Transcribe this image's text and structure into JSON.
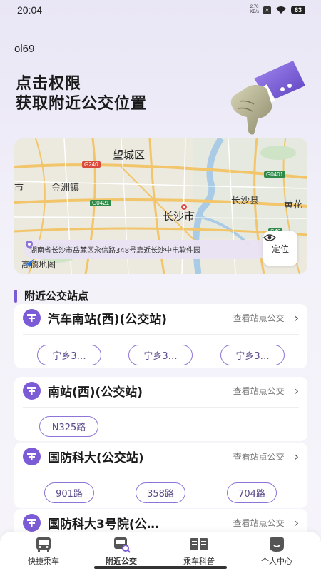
{
  "status_bar": {
    "time": "20:04",
    "net_speed_value": "2.70",
    "net_speed_unit": "KB/s",
    "battery": "63"
  },
  "app_code": "ol69",
  "headline": {
    "line1": "点击权限",
    "line2": "获取附近公交位置"
  },
  "map": {
    "labels": {
      "wangcheng": "望城区",
      "jinzhou": "金洲镇",
      "changsha_county": "长沙县",
      "changsha_city": "长沙市",
      "huanghua": "黄花",
      "edge_left": "市"
    },
    "road_tags": {
      "g240": "G240",
      "g0421": "G0421",
      "g0401": "G0401",
      "s40": "S40"
    },
    "address": "湖南省长沙市岳麓区永信路348号靠近长沙中电软件园",
    "locate_label": "定位",
    "logo_text": "高德地图"
  },
  "section": {
    "title": "附近公交站点"
  },
  "stops": [
    {
      "name": "汽车南站(西)(公交站)",
      "see_more": "查看站点公交",
      "routes": [
        "宁乡3…",
        "宁乡3…",
        "宁乡3…"
      ]
    },
    {
      "name": "南站(西)(公交站)",
      "see_more": "查看站点公交",
      "routes": [
        "N325路"
      ]
    },
    {
      "name": "国防科大(公交站)",
      "see_more": "查看站点公交",
      "routes": [
        "901路",
        "358路",
        "704路"
      ]
    },
    {
      "name": "国防科大3号院(公…",
      "see_more": "查看站点公交",
      "routes": []
    }
  ],
  "bottom_nav": [
    {
      "label": "快捷乘车",
      "icon": "bus-front-icon"
    },
    {
      "label": "附近公交",
      "icon": "bus-search-icon",
      "active": true
    },
    {
      "label": "乘车科普",
      "icon": "book-icon"
    },
    {
      "label": "个人中心",
      "icon": "smile-icon"
    }
  ],
  "colors": {
    "accent": "#7b5cd6",
    "background": "#f3f1f9"
  }
}
